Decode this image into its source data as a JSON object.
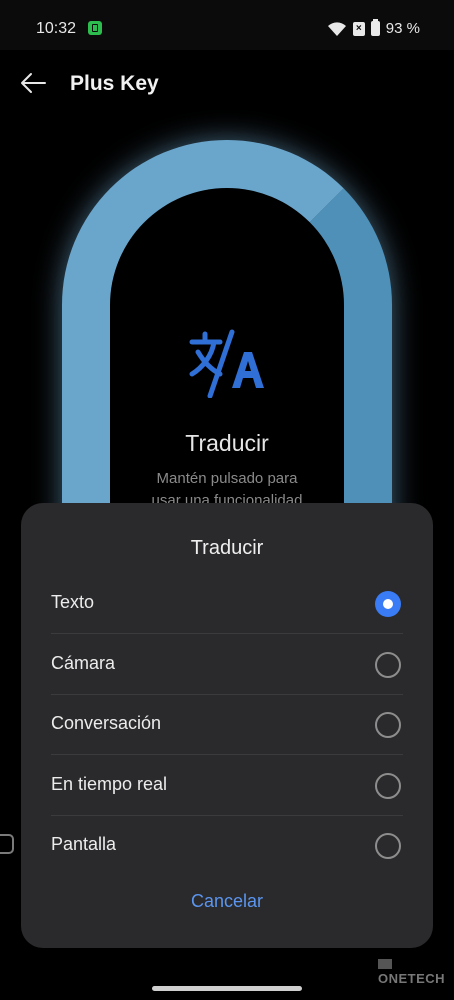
{
  "status_bar": {
    "time": "10:32",
    "battery": "93 %",
    "icons": [
      "notification-app-icon",
      "wifi-icon",
      "sim-error-icon",
      "battery-icon"
    ]
  },
  "header": {
    "back_icon": "arrow-left-icon",
    "title": "Plus Key"
  },
  "feature": {
    "icon": "translate-icon",
    "title": "Traducir",
    "description_line1": "Mantén pulsado para",
    "description_line2": "usar una funcionalidad"
  },
  "dialog": {
    "title": "Traducir",
    "options": [
      {
        "label": "Texto",
        "selected": true
      },
      {
        "label": "Cámara",
        "selected": false
      },
      {
        "label": "Conversación",
        "selected": false
      },
      {
        "label": "En tiempo real",
        "selected": false
      },
      {
        "label": "Pantalla",
        "selected": false
      }
    ],
    "cancel_label": "Cancelar"
  },
  "watermark": "ONETECH",
  "colors": {
    "accent": "#3a7cf6",
    "cancel_text": "#5b95ef",
    "key_glow": "#5a9cc4",
    "sheet_bg": "#2a2a2c"
  }
}
